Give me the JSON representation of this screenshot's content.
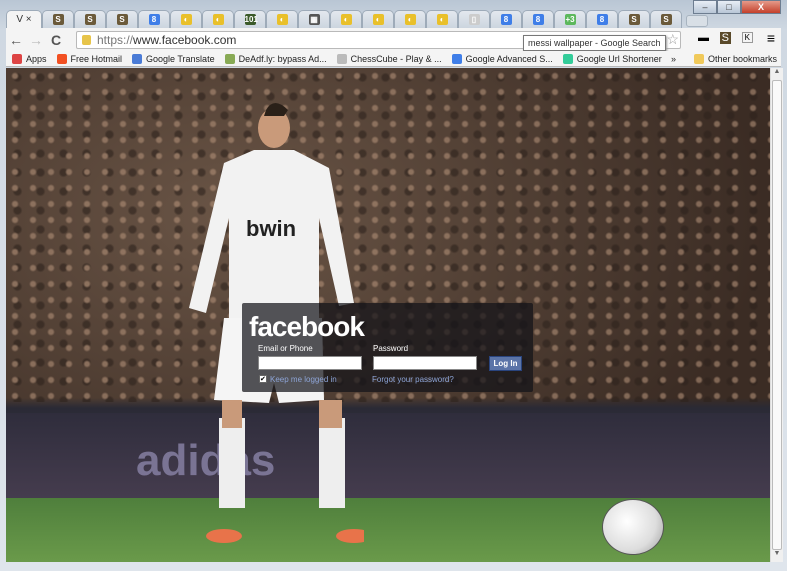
{
  "window": {
    "minimize": "–",
    "maximize": "□",
    "close": "X"
  },
  "tabs": [
    {
      "label": "V",
      "close": "×",
      "active": true
    },
    {
      "icon": "S",
      "color": "#6b5a3a"
    },
    {
      "icon": "S",
      "color": "#6b5a3a"
    },
    {
      "icon": "S",
      "color": "#6b5a3a"
    },
    {
      "icon": "8",
      "color": "#3f7ee8"
    },
    {
      "icon": "◐",
      "color": "#e9c02a"
    },
    {
      "icon": "◐",
      "color": "#e9c02a"
    },
    {
      "icon": "101",
      "color": "#3b5a2a"
    },
    {
      "icon": "◐",
      "color": "#e9c02a"
    },
    {
      "icon": "▦",
      "color": "#555"
    },
    {
      "icon": "◐",
      "color": "#e9c02a"
    },
    {
      "icon": "◐",
      "color": "#e9c02a"
    },
    {
      "icon": "◐",
      "color": "#e9c02a"
    },
    {
      "icon": "◐",
      "color": "#e9c02a"
    },
    {
      "icon": "▯",
      "color": "#ccc"
    },
    {
      "icon": "8",
      "color": "#3f7ee8"
    },
    {
      "icon": "8",
      "color": "#3f7ee8"
    },
    {
      "icon": "+3",
      "color": "#5cb85c"
    },
    {
      "icon": "8",
      "color": "#3f7ee8"
    },
    {
      "icon": "S",
      "color": "#6b5a3a"
    },
    {
      "icon": "S",
      "color": "#6b5a3a"
    }
  ],
  "toolbar": {
    "url_scheme": "https://",
    "url_host": "www.facebook.com",
    "tooltip": "messi wallpaper - Google Search",
    "back": "←",
    "forward": "→",
    "reload": "C",
    "star": "☆",
    "menu": "≡",
    "ext1": "▬",
    "ext2": "S",
    "ext3": "K"
  },
  "bookmarks": [
    {
      "label": "Apps",
      "color": "#d44"
    },
    {
      "label": "Free Hotmail",
      "color": "#f25022"
    },
    {
      "label": "Google Translate",
      "color": "#4a7bd6"
    },
    {
      "label": "DeAdf.ly: bypass Ad...",
      "color": "#8a5"
    },
    {
      "label": "ChessCube - Play & ...",
      "color": "#bbb"
    },
    {
      "label": "Google Advanced S...",
      "color": "#3f7ee8"
    },
    {
      "label": "Google Url Shortener",
      "color": "#3c9"
    }
  ],
  "bookmarks_overflow": "»",
  "other_bookmarks": "Other bookmarks",
  "page": {
    "banner_text": "adidas",
    "jersey_text": "bwin",
    "login": {
      "logo": "facebook",
      "email_label": "Email or Phone",
      "password_label": "Password",
      "login_button": "Log In",
      "keep_logged": "Keep me logged in",
      "forgot": "Forgot your password?"
    }
  }
}
